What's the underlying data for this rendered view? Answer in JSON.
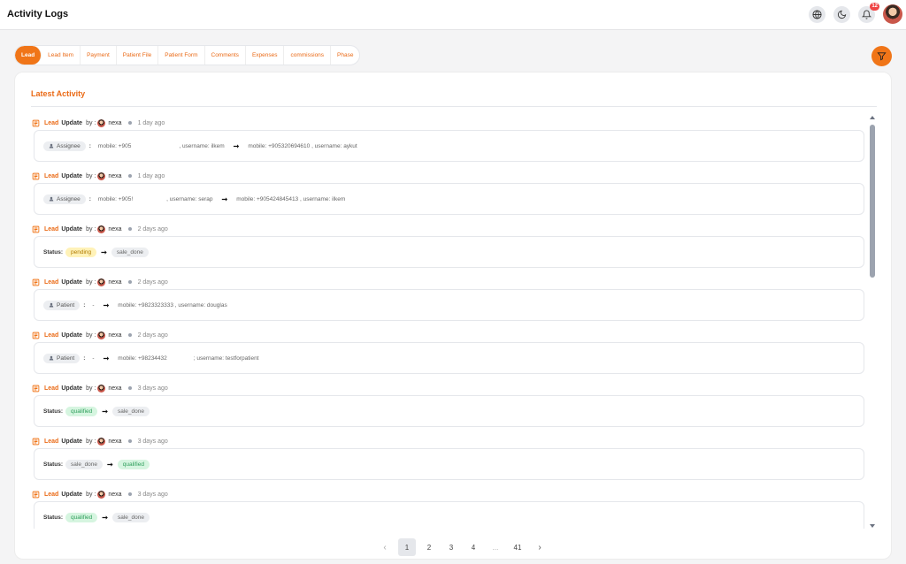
{
  "header": {
    "title": "Activity Logs",
    "notification_count": "12"
  },
  "tabs": [
    "Lead",
    "Lead Item",
    "Payment",
    "Patient File",
    "Patient Form",
    "Comments",
    "Expenses",
    "commissions",
    "Phase"
  ],
  "card": {
    "title": "Latest Activity"
  },
  "entries": [
    {
      "type": "Lead",
      "action": "Update",
      "by": "by :",
      "actor": "nexa",
      "time": "1 day ago",
      "field": "Assignee",
      "from": "mobile: +905",
      "from_extra": ", username: ilkem",
      "to": "mobile: +905320694610 , username: aykut"
    },
    {
      "type": "Lead",
      "action": "Update",
      "by": "by :",
      "actor": "nexa",
      "time": "1 day ago",
      "field": "Assignee",
      "from": "mobile: +905!",
      "from_extra": ", username: serap",
      "to": "mobile: +905424845413 , username: ilkem"
    },
    {
      "type": "Lead",
      "action": "Update",
      "by": "by :",
      "actor": "nexa",
      "time": "2 days ago",
      "status_label": "Status:",
      "from": "pending",
      "to": "sale_done"
    },
    {
      "type": "Lead",
      "action": "Update",
      "by": "by :",
      "actor": "nexa",
      "time": "2 days ago",
      "field": "Patient",
      "from": "-",
      "to": "mobile: +9823323333 , username: douglas"
    },
    {
      "type": "Lead",
      "action": "Update",
      "by": "by :",
      "actor": "nexa",
      "time": "2 days ago",
      "field": "Patient",
      "from": "-",
      "to": "mobile: +98234432",
      "to_extra": "; username: testforpatient"
    },
    {
      "type": "Lead",
      "action": "Update",
      "by": "by :",
      "actor": "nexa",
      "time": "3 days ago",
      "status_label": "Status:",
      "from": "qualified",
      "to": "sale_done"
    },
    {
      "type": "Lead",
      "action": "Update",
      "by": "by :",
      "actor": "nexa",
      "time": "3 days ago",
      "status_label": "Status:",
      "from": "sale_done",
      "to": "qualified"
    },
    {
      "type": "Lead",
      "action": "Update",
      "by": "by :",
      "actor": "nexa",
      "time": "3 days ago",
      "status_label": "Status:",
      "from": "qualified",
      "to": "sale_done"
    }
  ],
  "pagination": {
    "pages": [
      "1",
      "2",
      "3",
      "4"
    ],
    "ellipsis": "...",
    "last": "41",
    "current": "1"
  },
  "colors": {
    "accent": "#f07518",
    "pending": "#fff2b8",
    "qualified": "#d6f5e0"
  }
}
